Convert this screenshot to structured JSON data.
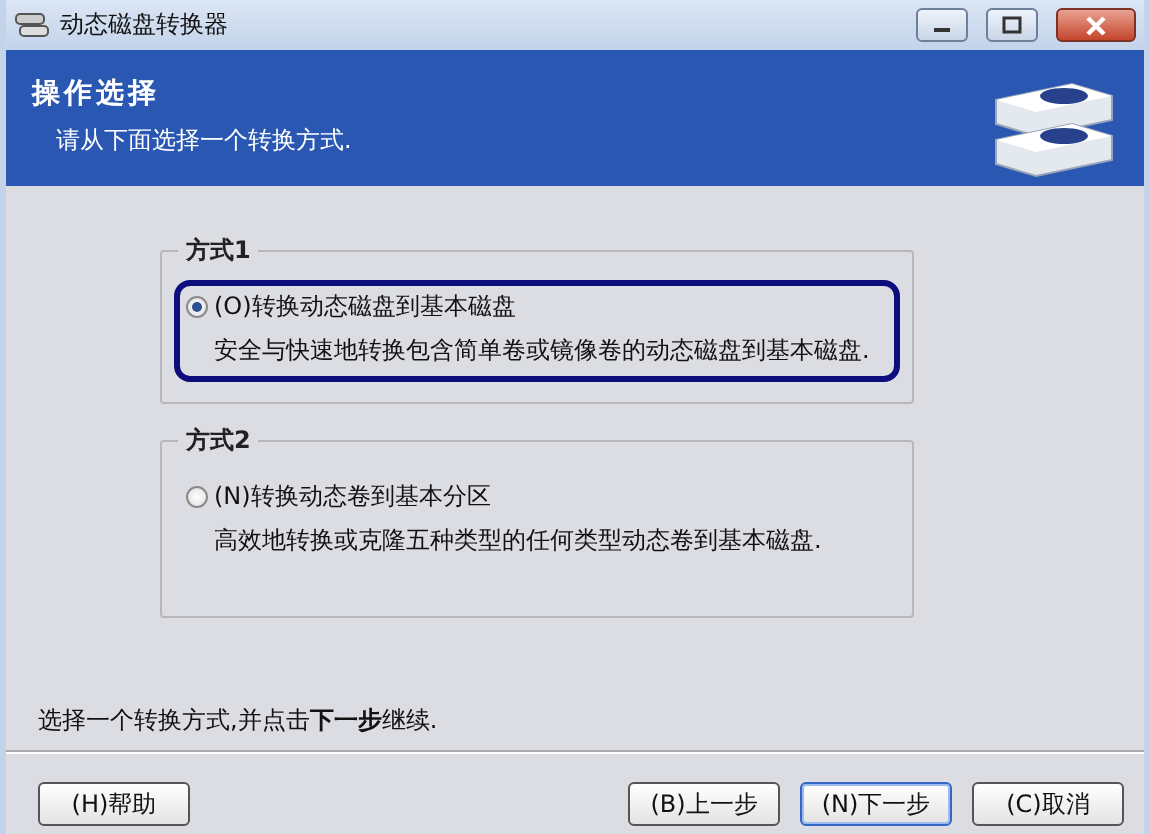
{
  "window": {
    "title": "动态磁盘转换器"
  },
  "header": {
    "title": "操作选择",
    "subtitle": "请从下面选择一个转换方式."
  },
  "options": [
    {
      "group": "方式1",
      "label": "(O)转换动态磁盘到基本磁盘",
      "description": "安全与快速地转换包含简单卷或镜像卷的动态磁盘到基本磁盘.",
      "selected": true
    },
    {
      "group": "方式2",
      "label": "(N)转换动态卷到基本分区",
      "description": "高效地转换或克隆五种类型的任何类型动态卷到基本磁盘.",
      "selected": false
    }
  ],
  "instruction": "选择一个转换方式,并点击**下一步**继续.",
  "buttons": [
    {
      "label": "(H)帮助",
      "kind": "help",
      "focused": false
    },
    {
      "label": "(B)上一步",
      "kind": "back",
      "focused": false
    },
    {
      "label": "(N)下一步",
      "kind": "next",
      "focused": true
    },
    {
      "label": "(C)取消",
      "kind": "cancel",
      "focused": false
    }
  ]
}
